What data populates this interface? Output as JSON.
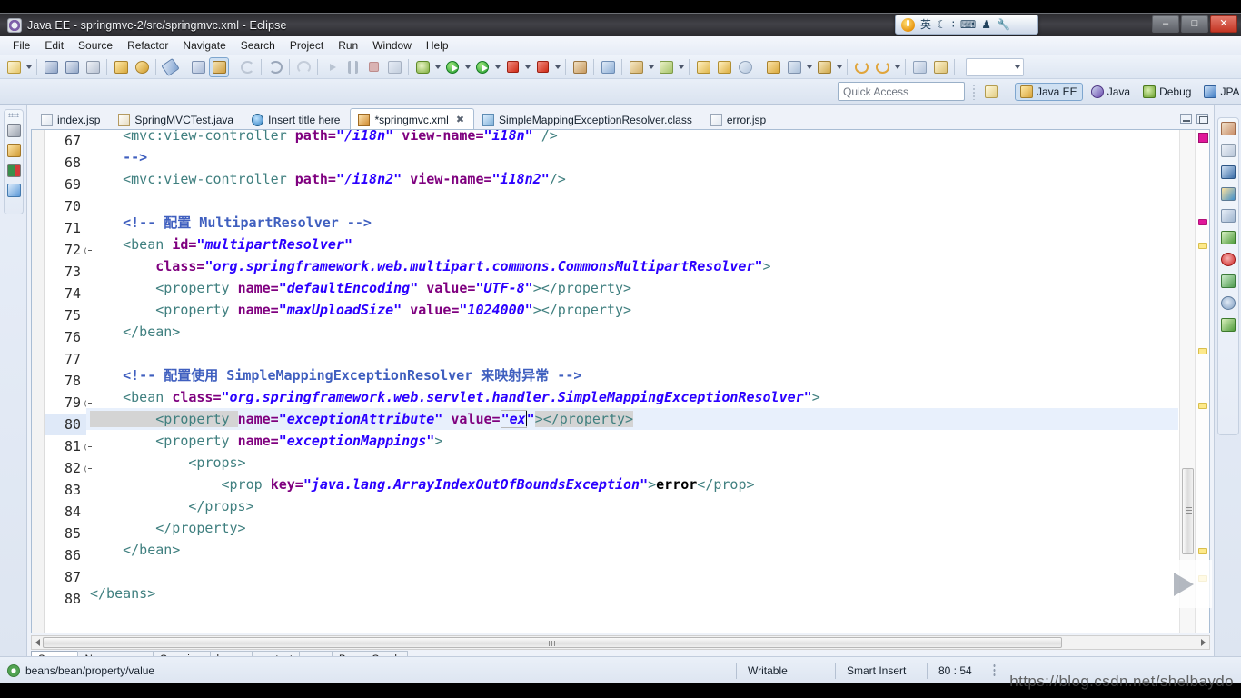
{
  "window": {
    "title": "Java EE - springmvc-2/src/springmvc.xml - Eclipse",
    "app_icon": "eclipse-icon",
    "minimize_label": "–",
    "maximize_label": "□",
    "close_label": "✕"
  },
  "ime": {
    "power_icon": "ime-power-icon",
    "mode_label": "英",
    "moon_icon": "☾",
    "punct_icon": "∶",
    "keyboard_icon": "⌨",
    "user_icon": "♟",
    "wrench_icon": "🔧"
  },
  "menubar": {
    "items": [
      {
        "label": "File"
      },
      {
        "label": "Edit"
      },
      {
        "label": "Source"
      },
      {
        "label": "Refactor"
      },
      {
        "label": "Navigate"
      },
      {
        "label": "Search"
      },
      {
        "label": "Project"
      },
      {
        "label": "Run"
      },
      {
        "label": "Window"
      },
      {
        "label": "Help"
      }
    ]
  },
  "quick_access": {
    "placeholder": "Quick Access",
    "value": ""
  },
  "perspectives": {
    "open_perspective_icon": "open-perspective-icon",
    "items": [
      {
        "label": "Java EE",
        "icon": "java-ee-perspective-icon",
        "active": true
      },
      {
        "label": "Java",
        "icon": "java-perspective-icon",
        "active": false
      },
      {
        "label": "Debug",
        "icon": "debug-perspective-icon",
        "active": false
      },
      {
        "label": "JPA",
        "icon": "jpa-perspective-icon",
        "active": false
      }
    ]
  },
  "left_strip": {
    "icons": [
      "project-explorer-icon",
      "markers-icon",
      "junit-icon",
      "outline-icon"
    ]
  },
  "right_strip": {
    "icons": [
      "servers-icon",
      "snippets-icon",
      "console-icon",
      "data-source-explorer-icon",
      "properties-icon",
      "palette-icon",
      "problems-icon",
      "task-list-icon",
      "search-view-icon",
      "progress-icon"
    ]
  },
  "editor_tabs": [
    {
      "label": "index.jsp",
      "icon": "jsp-file-icon",
      "active": false,
      "dirty": false
    },
    {
      "label": "SpringMVCTest.java",
      "icon": "java-file-icon",
      "active": false,
      "dirty": false
    },
    {
      "label": "Insert title here",
      "icon": "html-file-icon",
      "active": false,
      "dirty": false
    },
    {
      "label": "*springmvc.xml",
      "icon": "xml-file-icon",
      "active": true,
      "dirty": true,
      "close_label": "✖"
    },
    {
      "label": "SimpleMappingExceptionResolver.class",
      "icon": "class-file-icon",
      "active": false,
      "dirty": false
    },
    {
      "label": "error.jsp",
      "icon": "jsp-file-icon",
      "active": false,
      "dirty": false
    }
  ],
  "editor": {
    "first_line": 67,
    "lines": [
      {
        "no": "67",
        "fold": false,
        "clipped": true,
        "tokens": [
          {
            "t": "tag",
            "s": "    <mvc:view-controller "
          },
          {
            "t": "attr",
            "s": "path="
          },
          {
            "t": "val",
            "s": "\"/i18n\" "
          },
          {
            "t": "attr",
            "s": "view-name="
          },
          {
            "t": "val",
            "s": "\"i18n\" "
          },
          {
            "t": "tag",
            "s": "/>"
          }
        ]
      },
      {
        "no": "68",
        "fold": false,
        "tokens": [
          {
            "t": "cmt",
            "s": "    -->"
          }
        ]
      },
      {
        "no": "69",
        "fold": false,
        "tokens": [
          {
            "t": "tag",
            "s": "    <mvc:view-controller "
          },
          {
            "t": "attr",
            "s": "path="
          },
          {
            "t": "val",
            "s": "\"/i18n2\" "
          },
          {
            "t": "attr",
            "s": "view-name="
          },
          {
            "t": "val",
            "s": "\"i18n2\""
          },
          {
            "t": "tag",
            "s": "/>"
          }
        ]
      },
      {
        "no": "70",
        "fold": false,
        "tokens": [
          {
            "t": "plain",
            "s": ""
          }
        ]
      },
      {
        "no": "71",
        "fold": false,
        "tokens": [
          {
            "t": "cmt",
            "s": "    <!-- 配置 MultipartResolver -->"
          }
        ]
      },
      {
        "no": "72",
        "fold": true,
        "tokens": [
          {
            "t": "tag",
            "s": "    <bean "
          },
          {
            "t": "attr",
            "s": "id="
          },
          {
            "t": "val",
            "s": "\"multipartResolver\""
          }
        ]
      },
      {
        "no": "73",
        "fold": false,
        "tokens": [
          {
            "t": "attr",
            "s": "        class="
          },
          {
            "t": "val",
            "s": "\"org.springframework.web.multipart.commons.CommonsMultipartResolver\""
          },
          {
            "t": "tag",
            "s": ">"
          }
        ]
      },
      {
        "no": "74",
        "fold": false,
        "tokens": [
          {
            "t": "tag",
            "s": "        <property "
          },
          {
            "t": "attr",
            "s": "name="
          },
          {
            "t": "val",
            "s": "\"defaultEncoding\" "
          },
          {
            "t": "attr",
            "s": "value="
          },
          {
            "t": "val",
            "s": "\"UTF-8\""
          },
          {
            "t": "tag",
            "s": "></property>"
          }
        ]
      },
      {
        "no": "75",
        "fold": false,
        "tokens": [
          {
            "t": "tag",
            "s": "        <property "
          },
          {
            "t": "attr",
            "s": "name="
          },
          {
            "t": "val",
            "s": "\"maxUploadSize\" "
          },
          {
            "t": "attr",
            "s": "value="
          },
          {
            "t": "val",
            "s": "\"1024000\""
          },
          {
            "t": "tag",
            "s": "></property>"
          }
        ]
      },
      {
        "no": "76",
        "fold": false,
        "tokens": [
          {
            "t": "tag",
            "s": "    </bean>"
          }
        ]
      },
      {
        "no": "77",
        "fold": false,
        "tokens": [
          {
            "t": "plain",
            "s": ""
          }
        ]
      },
      {
        "no": "78",
        "fold": false,
        "tokens": [
          {
            "t": "cmt",
            "s": "    <!-- 配置使用 SimpleMappingExceptionResolver 来映射异常 -->"
          }
        ]
      },
      {
        "no": "79",
        "fold": true,
        "tokens": [
          {
            "t": "tag",
            "s": "    <bean "
          },
          {
            "t": "attr",
            "s": "class="
          },
          {
            "t": "val",
            "s": "\"org.springframework.web.servlet.handler.SimpleMappingExceptionResolver\""
          },
          {
            "t": "tag",
            "s": ">"
          }
        ]
      },
      {
        "no": "80",
        "fold": false,
        "highlight": true,
        "tokens": [
          {
            "t": "tag-sel",
            "s": "        <property "
          },
          {
            "t": "attr",
            "s": "name="
          },
          {
            "t": "val",
            "s": "\"exceptionAttribute\" "
          },
          {
            "t": "attr",
            "s": "value="
          },
          {
            "t": "val-box",
            "s": "\"ex"
          },
          {
            "t": "caret",
            "s": ""
          },
          {
            "t": "val",
            "s": "\""
          },
          {
            "t": "tag-sel2",
            "s": "></property>"
          }
        ]
      },
      {
        "no": "81",
        "fold": true,
        "tokens": [
          {
            "t": "tag",
            "s": "        <property "
          },
          {
            "t": "attr",
            "s": "name="
          },
          {
            "t": "val",
            "s": "\"exceptionMappings\""
          },
          {
            "t": "tag",
            "s": ">"
          }
        ]
      },
      {
        "no": "82",
        "fold": true,
        "tokens": [
          {
            "t": "tag",
            "s": "            <props>"
          }
        ]
      },
      {
        "no": "83",
        "fold": false,
        "tokens": [
          {
            "t": "tag",
            "s": "                <prop "
          },
          {
            "t": "attr",
            "s": "key="
          },
          {
            "t": "val",
            "s": "\"java.lang.ArrayIndexOutOfBoundsException\""
          },
          {
            "t": "tag",
            "s": ">"
          },
          {
            "t": "txt",
            "s": "error"
          },
          {
            "t": "tag",
            "s": "</prop>"
          }
        ]
      },
      {
        "no": "84",
        "fold": false,
        "tokens": [
          {
            "t": "tag",
            "s": "            </props>"
          }
        ]
      },
      {
        "no": "85",
        "fold": false,
        "tokens": [
          {
            "t": "tag",
            "s": "        </property>"
          }
        ]
      },
      {
        "no": "86",
        "fold": false,
        "tokens": [
          {
            "t": "tag",
            "s": "    </bean>"
          }
        ]
      },
      {
        "no": "87",
        "fold": false,
        "tokens": [
          {
            "t": "plain",
            "s": ""
          }
        ]
      },
      {
        "no": "88",
        "fold": false,
        "tokens": [
          {
            "t": "tag",
            "s": "</beans>"
          }
        ]
      }
    ]
  },
  "page_tabs": [
    {
      "label": "Source",
      "active": true
    },
    {
      "label": "Namespaces",
      "active": false
    },
    {
      "label": "Overview",
      "active": false
    },
    {
      "label": "beans",
      "active": false
    },
    {
      "label": "context",
      "active": false
    },
    {
      "label": "mvc",
      "active": false
    },
    {
      "label": "Beans Graph",
      "active": false
    }
  ],
  "statusbar": {
    "icon": "xpath-indicator-icon",
    "path": "beans/bean/property/value",
    "writable": "Writable",
    "insert_mode": "Smart Insert",
    "position": "80 : 54"
  },
  "watermark": "https://blog.csdn.net/shelbaydo",
  "colors": {
    "tag": "#3f7f7f",
    "attribute": "#7f007f",
    "value": "#2a00ff",
    "comment": "#3f5fbf",
    "selection": "#d4d4d4",
    "line_highlight": "#e8f0fc",
    "accent": "#cfe0f2",
    "error_marker": "#e0189a",
    "warn_marker": "#fde98b"
  }
}
